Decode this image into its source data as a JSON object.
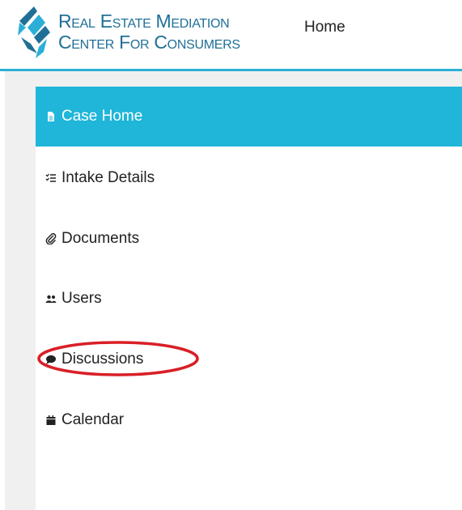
{
  "header": {
    "logo_line1": "Real Estate Mediation",
    "logo_line2": "Center For Consumers",
    "nav_home": "Home"
  },
  "sidebar": {
    "items": [
      {
        "label": "Case Home",
        "icon": "document-icon",
        "active": true
      },
      {
        "label": "Intake Details",
        "icon": "checklist-icon",
        "active": false
      },
      {
        "label": "Documents",
        "icon": "paperclip-icon",
        "active": false
      },
      {
        "label": "Users",
        "icon": "users-icon",
        "active": false
      },
      {
        "label": "Discussions",
        "icon": "chat-bubble-icon",
        "active": false
      },
      {
        "label": "Calendar",
        "icon": "calendar-icon",
        "active": false
      }
    ]
  },
  "colors": {
    "accent": "#1fb6da",
    "logo_text": "#1f6f96",
    "annotation": "#d91f26",
    "page_bg": "#f0f0f0"
  }
}
